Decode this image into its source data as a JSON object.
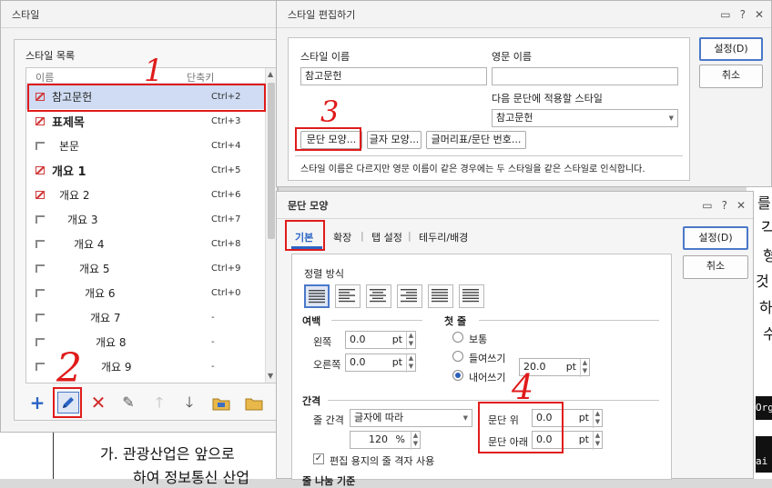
{
  "style_window": {
    "title": "스타일",
    "list_title": "스타일 목록",
    "col_name": "이름",
    "col_shortcut": "단축키",
    "items": [
      {
        "name": "참고문헌",
        "shortcut": "Ctrl+2",
        "icon": "checkmark-icon",
        "bold": false,
        "indent": 0,
        "selected": true
      },
      {
        "name": "표제목",
        "shortcut": "Ctrl+3",
        "icon": "checkmark-icon",
        "bold": true,
        "indent": 0
      },
      {
        "name": "본문",
        "shortcut": "Ctrl+4",
        "icon": "paragraph-icon",
        "bold": false,
        "indent": 8
      },
      {
        "name": "개요 1",
        "shortcut": "Ctrl+5",
        "icon": "checkmark-icon",
        "bold": true,
        "indent": 0
      },
      {
        "name": "개요 2",
        "shortcut": "Ctrl+6",
        "icon": "checkmark-icon",
        "bold": false,
        "indent": 8
      },
      {
        "name": "개요 3",
        "shortcut": "Ctrl+7",
        "icon": "paragraph-icon",
        "bold": false,
        "indent": 17
      },
      {
        "name": "개요 4",
        "shortcut": "Ctrl+8",
        "icon": "paragraph-icon",
        "bold": false,
        "indent": 24
      },
      {
        "name": "개요 5",
        "shortcut": "Ctrl+9",
        "icon": "paragraph-icon",
        "bold": false,
        "indent": 30
      },
      {
        "name": "개요 6",
        "shortcut": "Ctrl+0",
        "icon": "paragraph-icon",
        "bold": false,
        "indent": 36
      },
      {
        "name": "개요 7",
        "shortcut": "-",
        "icon": "paragraph-icon",
        "bold": false,
        "indent": 42
      },
      {
        "name": "개요 8",
        "shortcut": "-",
        "icon": "paragraph-icon",
        "bold": false,
        "indent": 48
      },
      {
        "name": "개요 9",
        "shortcut": "-",
        "icon": "paragraph-icon",
        "bold": false,
        "indent": 54
      }
    ],
    "toolbar_icons": [
      "add-icon",
      "edit-icon",
      "delete-icon",
      "replace-style-icon",
      "move-up-icon",
      "move-down-icon",
      "import-icon",
      "export-icon"
    ]
  },
  "edit_window": {
    "title": "스타일 편집하기",
    "style_name_label": "스타일 이름",
    "style_name_value": "참고문헌",
    "english_name_label": "영문 이름",
    "english_name_value": "",
    "next_style_label": "다음 문단에 적용할 스타일",
    "next_style_value": "참고문헌",
    "btn_paragraph": "문단 모양...",
    "btn_char": "글자 모양...",
    "btn_bullet": "글머리표/문단 번호...",
    "note": "스타일 이름은 다르지만 영문 이름이 같은 경우에는 두 스타일을 같은 스타일로 인식합니다.",
    "ok": "설정(D)",
    "cancel": "취소"
  },
  "para_window": {
    "title": "문단 모양",
    "tabs": [
      "기본",
      "확장",
      "탭 설정",
      "테두리/배경"
    ],
    "tab_sep": "|",
    "ok": "설정(D)",
    "cancel": "취소",
    "align_label": "정렬 방식",
    "align_buttons": [
      "justify-align-icon",
      "left-align-icon",
      "center-align-icon",
      "right-align-icon",
      "distribute-align-icon",
      "divide-align-icon"
    ],
    "margin_label": "여백",
    "left_label": "왼쪽",
    "left_value": "0.0",
    "right_label": "오른쪽",
    "right_value": "0.0",
    "unit_pt": "pt",
    "first_line_label": "첫 줄",
    "radio_normal": "보통",
    "radio_indent": "들여쓰기",
    "radio_hanging": "내어쓰기",
    "hanging_value": "20.0",
    "spacing_label": "간격",
    "line_spacing_label": "줄 간격",
    "line_spacing_type": "글자에 따라",
    "line_spacing_value": "120",
    "unit_pct": "%",
    "para_above_label": "문단 위",
    "para_above_value": "0.0",
    "para_below_label": "문단 아래",
    "para_below_value": "0.0",
    "grid_checkbox": "편집 용지의 줄 격자 사용",
    "cutoff_label": "줄 나눔 기준"
  },
  "annotations": [
    "1",
    "2",
    "3",
    "4"
  ],
  "doc": {
    "line1": "가. 관광산업은 앞으로",
    "line2": "하여 정보통신 산업",
    "right_fragments": [
      "를",
      "각",
      "형",
      "것",
      "하",
      "수"
    ],
    "black_label_1": "Org",
    "black_label_2": "ai"
  },
  "colors": {
    "annotation_red": "#e01b1b",
    "accent_blue": "#4a78c8",
    "selected_row": "#cfdcf3"
  }
}
